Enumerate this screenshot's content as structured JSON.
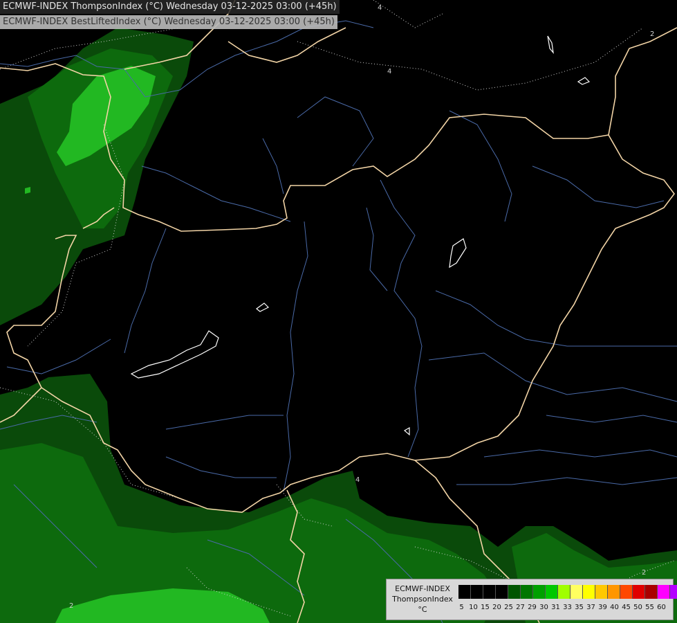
{
  "header": {
    "title_primary": "ECMWF-INDEX ThompsonIndex (°C) Wednesday 03-12-2025 03:00 (+45h)",
    "title_secondary": "ECMWF-INDEX BestLiftedIndex (°C) Wednesday 03-12-2025 03:00 (+45h)"
  },
  "legend": {
    "model": "ECMWF-INDEX",
    "parameter": "ThompsonIndex",
    "unit": "°C",
    "ticks": [
      "5",
      "10",
      "15",
      "20",
      "25",
      "27",
      "29",
      "30",
      "31",
      "33",
      "35",
      "37",
      "39",
      "40",
      "45",
      "50",
      "55",
      "60"
    ],
    "colors": [
      "#000000",
      "#000000",
      "#000000",
      "#000000",
      "#005500",
      "#007700",
      "#00a000",
      "#00c800",
      "#a0ff00",
      "#ffff60",
      "#ffff00",
      "#ffc800",
      "#ff9600",
      "#ff4800",
      "#e00000",
      "#aa0000",
      "#ff00ff",
      "#b400ff",
      "#7800ff",
      "#0000ff"
    ]
  },
  "contour_labels": [
    "4",
    "4",
    "4",
    "2",
    "2",
    "2"
  ],
  "colors": {
    "background": "#000000",
    "green_dark": "#0a4a0a",
    "green_mid": "#0d6a0d",
    "green_light": "#22b822",
    "border": "#f2d4a6",
    "river": "#4a6aa8",
    "contour": "#cfcfcf",
    "lake": "#ffffff"
  }
}
